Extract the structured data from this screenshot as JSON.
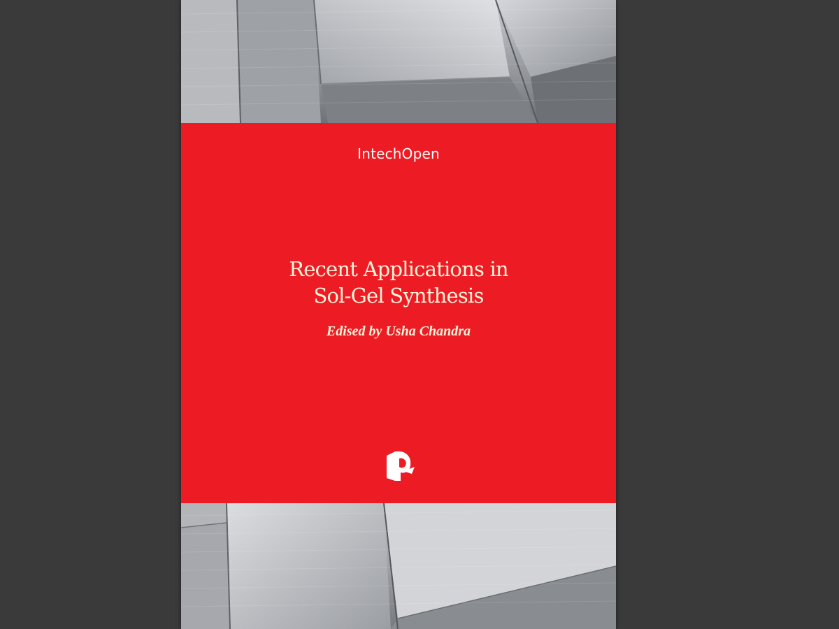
{
  "cover": {
    "publisher": "IntechOpen",
    "title_line1": "Recent Applications in",
    "title_line2": "Sol-Gel Synthesis",
    "editor": "Edised by Usha Chandra"
  },
  "colors": {
    "band": "#ed1c24",
    "text_light": "#fdf4dc",
    "viewer_bg": "#3a3a3a"
  },
  "icons": {
    "publisher_logo": "intechopen-logo-icon"
  }
}
